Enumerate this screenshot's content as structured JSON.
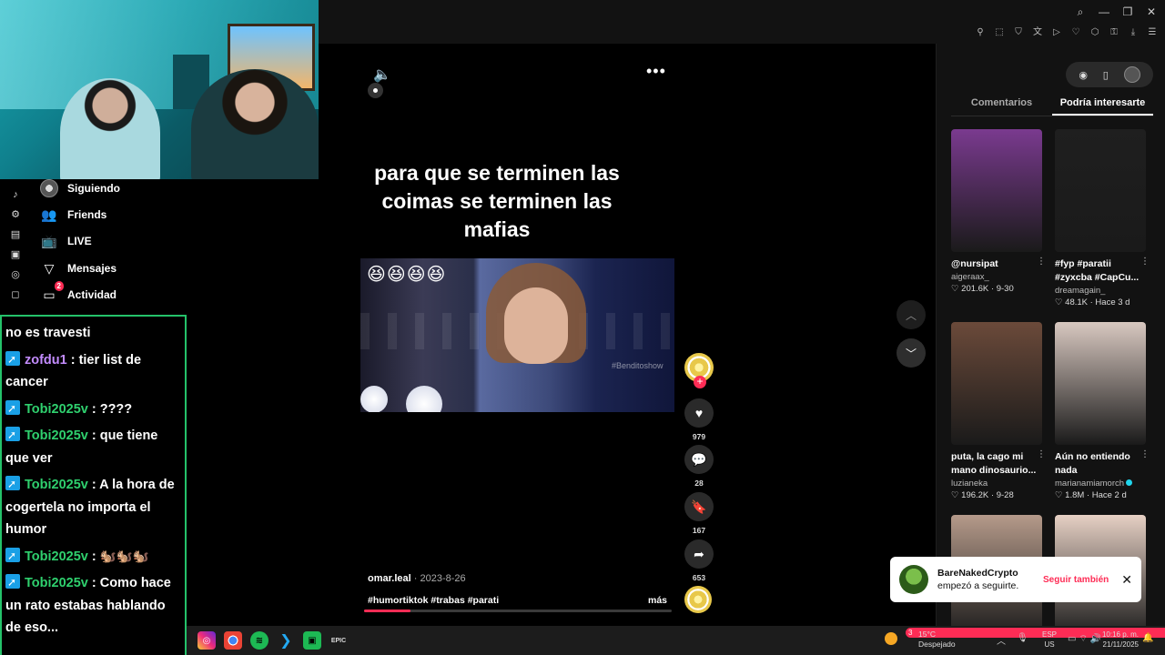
{
  "browser": {
    "window_controls": [
      "search-icon",
      "minimize-icon",
      "restore-icon",
      "close-icon"
    ],
    "extensions": [
      "pin-icon",
      "crop-icon",
      "shield-icon",
      "translate-icon",
      "play-icon",
      "heart-icon",
      "puzzle-icon",
      "lock-icon",
      "download-icon",
      "menu-icon"
    ]
  },
  "sidebar": {
    "items": [
      {
        "label": "Siguiendo",
        "icon": "avatar"
      },
      {
        "label": "Friends",
        "icon": "friends-icon"
      },
      {
        "label": "LIVE",
        "icon": "live-icon"
      },
      {
        "label": "Mensajes",
        "icon": "messages-icon"
      },
      {
        "label": "Actividad",
        "icon": "activity-icon",
        "badge": "2"
      }
    ]
  },
  "chat": {
    "messages": [
      {
        "user": "",
        "text": "no es travesti"
      },
      {
        "user": "zofdu1",
        "text": ": tier list de cancer",
        "color": "#c38cff"
      },
      {
        "user": "Tobi2025v",
        "text": ": ????",
        "color": "#2fd06e"
      },
      {
        "user": "Tobi2025v",
        "text": ": que tiene que ver",
        "color": "#2fd06e"
      },
      {
        "user": "Tobi2025v",
        "text": ": A la hora de cogertela no importa el humor",
        "color": "#2fd06e"
      },
      {
        "user": "Tobi2025v",
        "text": ": 🐿️🐿️🐿️",
        "color": "#2fd06e"
      },
      {
        "user": "Tobi2025v",
        "text": ": Como hace un rato estabas hablando de eso...",
        "color": "#2fd06e"
      }
    ]
  },
  "video": {
    "caption": "para que se terminen las coimas se terminen las mafias",
    "emojis": "😆😆😆😆",
    "watermark": "#Benditoshow",
    "author": "omar.leal",
    "date": "· 2023-8-26",
    "tags": "#humortiktok #trabas #parati",
    "more": "más",
    "progress": 0.15
  },
  "actions": {
    "likes": "979",
    "comments": "28",
    "saves": "167",
    "shares": "653"
  },
  "panel": {
    "tabs": [
      "Comentarios",
      "Podría interesarte"
    ],
    "active_tab": 1,
    "recommendations": [
      {
        "title": "@nursipat",
        "user": "aigeraax_",
        "stats": "♡ 201.6K · 9-30",
        "thumb": "#7a3a8f",
        "verified": false
      },
      {
        "title": "#fyp #paratii #zyxcba #CapCu...",
        "user": "dreamagain_",
        "stats": "♡ 48.1K · Hace 3 d",
        "thumb": "#1f1f1f",
        "verified": false
      },
      {
        "title": "puta, la cago mi mano dinosaurio...",
        "user": "luzianeka",
        "stats": "♡ 196.2K · 9-28",
        "thumb": "#6b4a3a",
        "verified": false
      },
      {
        "title": "Aún no entiendo nada",
        "user": "marianamiamorch",
        "stats": "♡ 1.8M · Hace 2 d",
        "thumb": "#d8c8c0",
        "verified": true
      },
      {
        "title": "",
        "user": "",
        "stats": "",
        "thumb": "#b59a8a",
        "verified": false
      },
      {
        "title": "",
        "user": "",
        "stats": "",
        "thumb": "#e6d0c4",
        "verified": false
      }
    ]
  },
  "toast": {
    "name": "BareNakedCrypto",
    "text": "empezó a seguirte.",
    "action": "Seguir también"
  },
  "taskbar": {
    "weather_temp": "15°C",
    "weather_text": "Despejado",
    "weather_badge": "3",
    "lang1": "ESP",
    "lang2": "US",
    "time": "10:16 p. m.",
    "date": "21/11/2025"
  }
}
